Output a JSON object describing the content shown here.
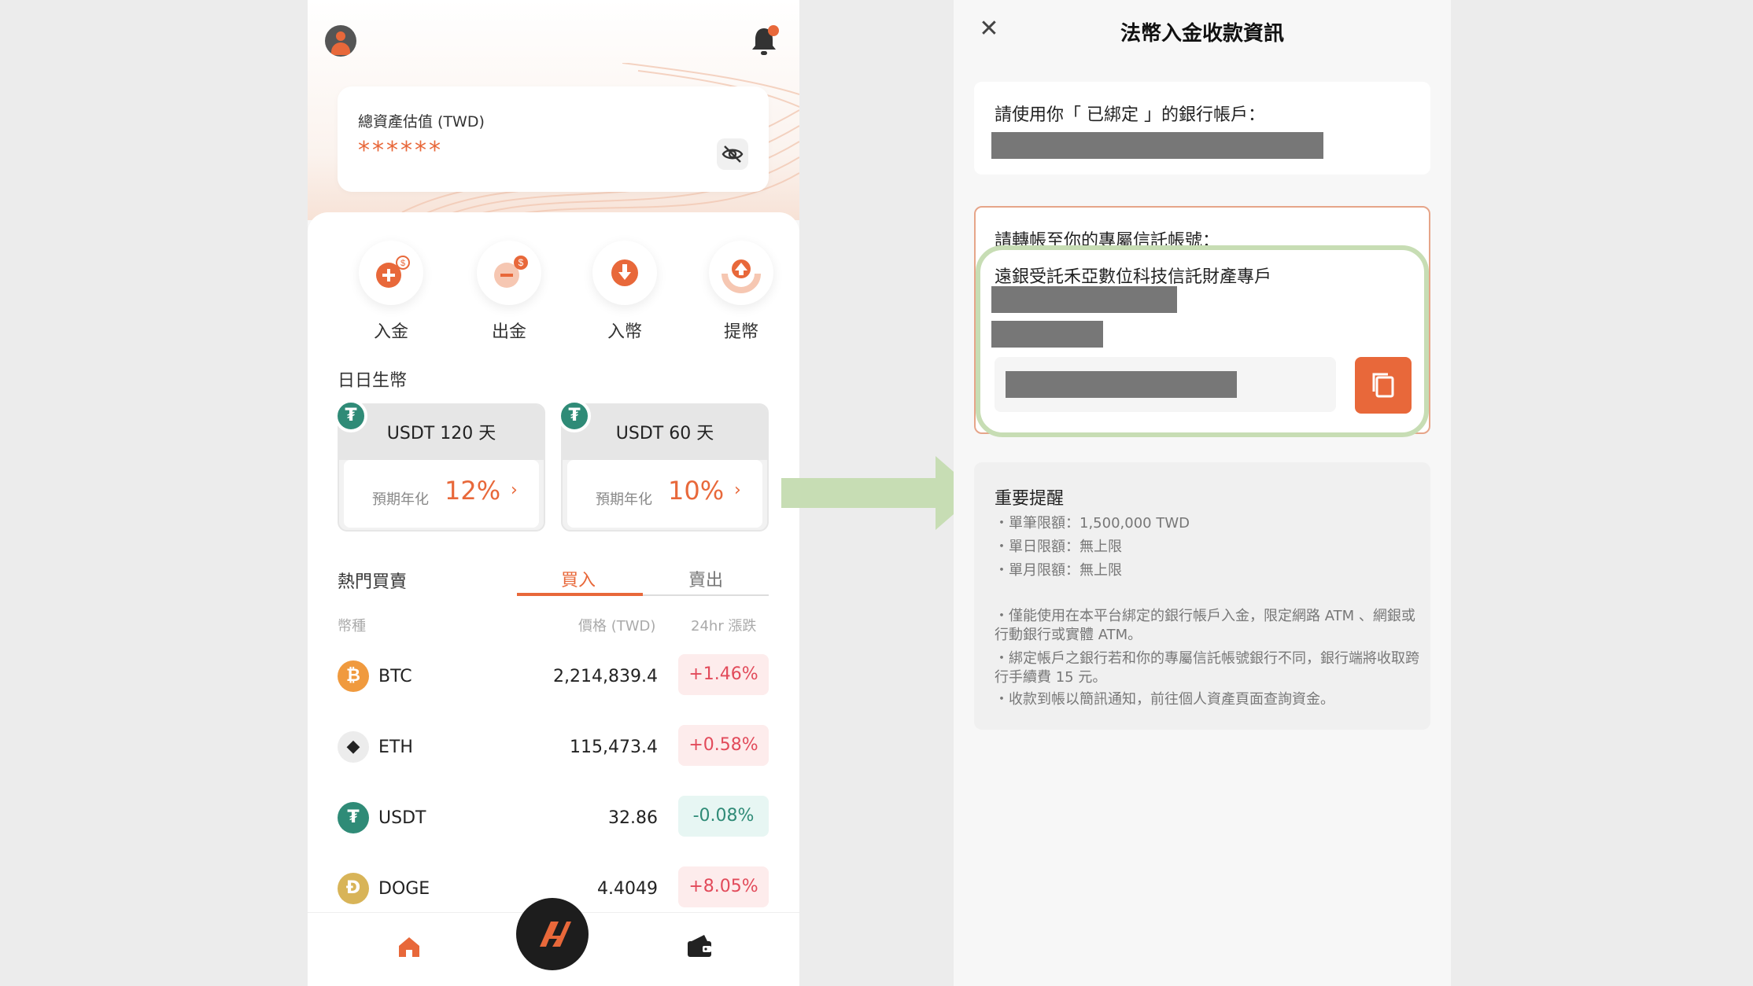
{
  "left_screen": {
    "asset": {
      "title": "總資產估值 (TWD)",
      "masked_value": "******"
    },
    "actions": [
      {
        "label": "入金",
        "icon": "deposit-plus-icon"
      },
      {
        "label": "出金",
        "icon": "withdraw-minus-icon"
      },
      {
        "label": "入幣",
        "icon": "coin-in-icon"
      },
      {
        "label": "提幣",
        "icon": "coin-out-icon"
      }
    ],
    "earn": {
      "title": "日日生幣",
      "products": [
        {
          "name": "USDT  120 天",
          "sub": "預期年化",
          "rate": "12%"
        },
        {
          "name": "USDT  60 天",
          "sub": "預期年化",
          "rate": "10%"
        }
      ]
    },
    "market": {
      "title": "熱門買賣",
      "tabs": [
        "買入",
        "賣出"
      ],
      "columns": [
        "幣種",
        "價格 (TWD)",
        "24hr 漲跌"
      ],
      "rows": [
        {
          "symbol": "BTC",
          "price": "2,214,839.4",
          "change": "+1.46%",
          "direction": "up",
          "color": "#f09a3e",
          "glyph": "₿"
        },
        {
          "symbol": "ETH",
          "price": "115,473.4",
          "change": "+0.58%",
          "direction": "up",
          "color": "#ececec",
          "glyph": "◆"
        },
        {
          "symbol": "USDT",
          "price": "32.86",
          "change": "-0.08%",
          "direction": "down",
          "color": "#2f8b77",
          "glyph": "₮"
        },
        {
          "symbol": "DOGE",
          "price": "4.4049",
          "change": "+8.05%",
          "direction": "up",
          "color": "#d8b458",
          "glyph": "Ð"
        }
      ]
    }
  },
  "right_screen": {
    "title": "法幣入金收款資訊",
    "bound_account_label": "請使用你「 已綁定 」的銀行帳戶：",
    "transfer_label": "請轉帳至你的專屬信託帳號：",
    "bank_name": "遠銀受託禾亞數位科技信託財產專戶",
    "notice": {
      "title": "重要提醒",
      "limits": [
        "・單筆限額：1,500,000 TWD",
        "・單日限額：無上限",
        "・單月限額：無上限"
      ],
      "notes": [
        "・僅能使用在本平台綁定的銀行帳戶入金，限定網路 ATM 、網銀或行動銀行或實體 ATM。",
        "・綁定帳戶之銀行若和你的專屬信託帳號銀行不同，銀行端將收取跨行手續費 15 元。",
        "・收款到帳以簡訊通知，前往個人資產頁面查詢資金。"
      ]
    }
  },
  "colors": {
    "accent": "#e8683a",
    "green_highlight": "#c7ddb4",
    "up": "#e24a5a",
    "down": "#2f8b77"
  }
}
